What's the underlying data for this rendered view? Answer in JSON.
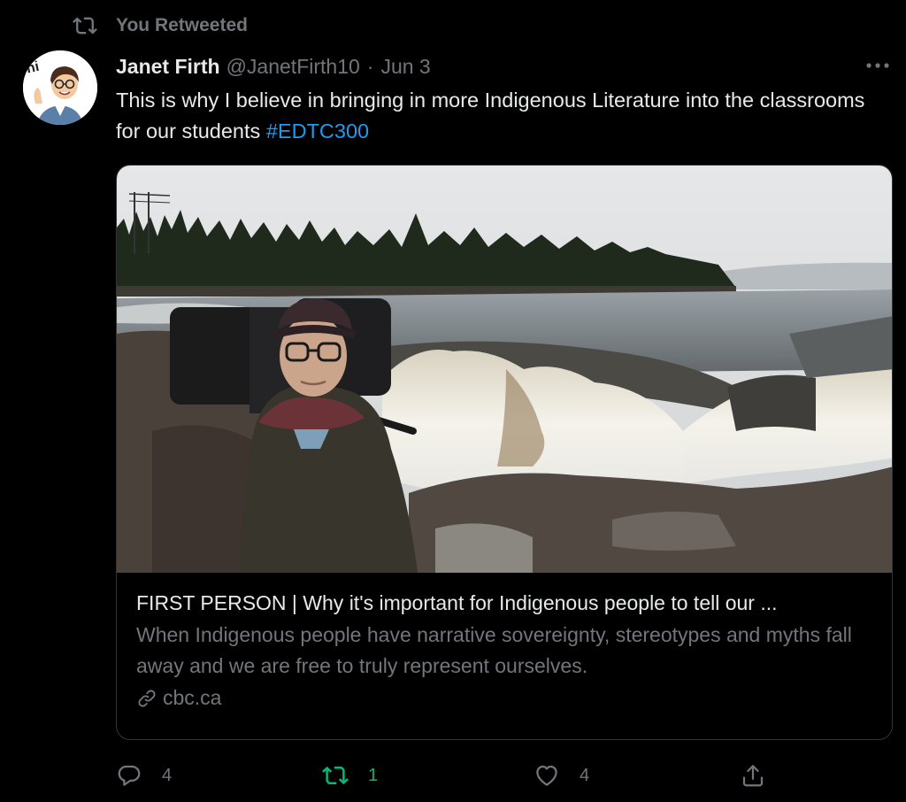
{
  "retweet_header": {
    "label": "You Retweeted",
    "icon": "retweet-icon"
  },
  "tweet": {
    "author_name": "Janet Firth",
    "handle": "@JanetFirth10",
    "separator": "·",
    "date": "Jun 3",
    "text": "This is why I believe in bringing in more Indigenous Literature into the classrooms for our students ",
    "hashtag": "#EDTC300"
  },
  "avatar": {
    "badge_text": "hi"
  },
  "card": {
    "title": "FIRST PERSON | Why it's important for Indigenous people to tell our ...",
    "description": "When Indigenous people have narrative sovereignty, stereotypes and myths fall away and we are free to truly represent ourselves.",
    "domain": "cbc.ca"
  },
  "actions": {
    "reply_count": "4",
    "retweet_count": "1",
    "like_count": "4"
  },
  "colors": {
    "background": "#000000",
    "text_primary": "#e7e9ea",
    "text_secondary": "#71767b",
    "accent_blue": "#1d9bf0",
    "retweet_green": "#00ba7c",
    "border": "#333639"
  }
}
